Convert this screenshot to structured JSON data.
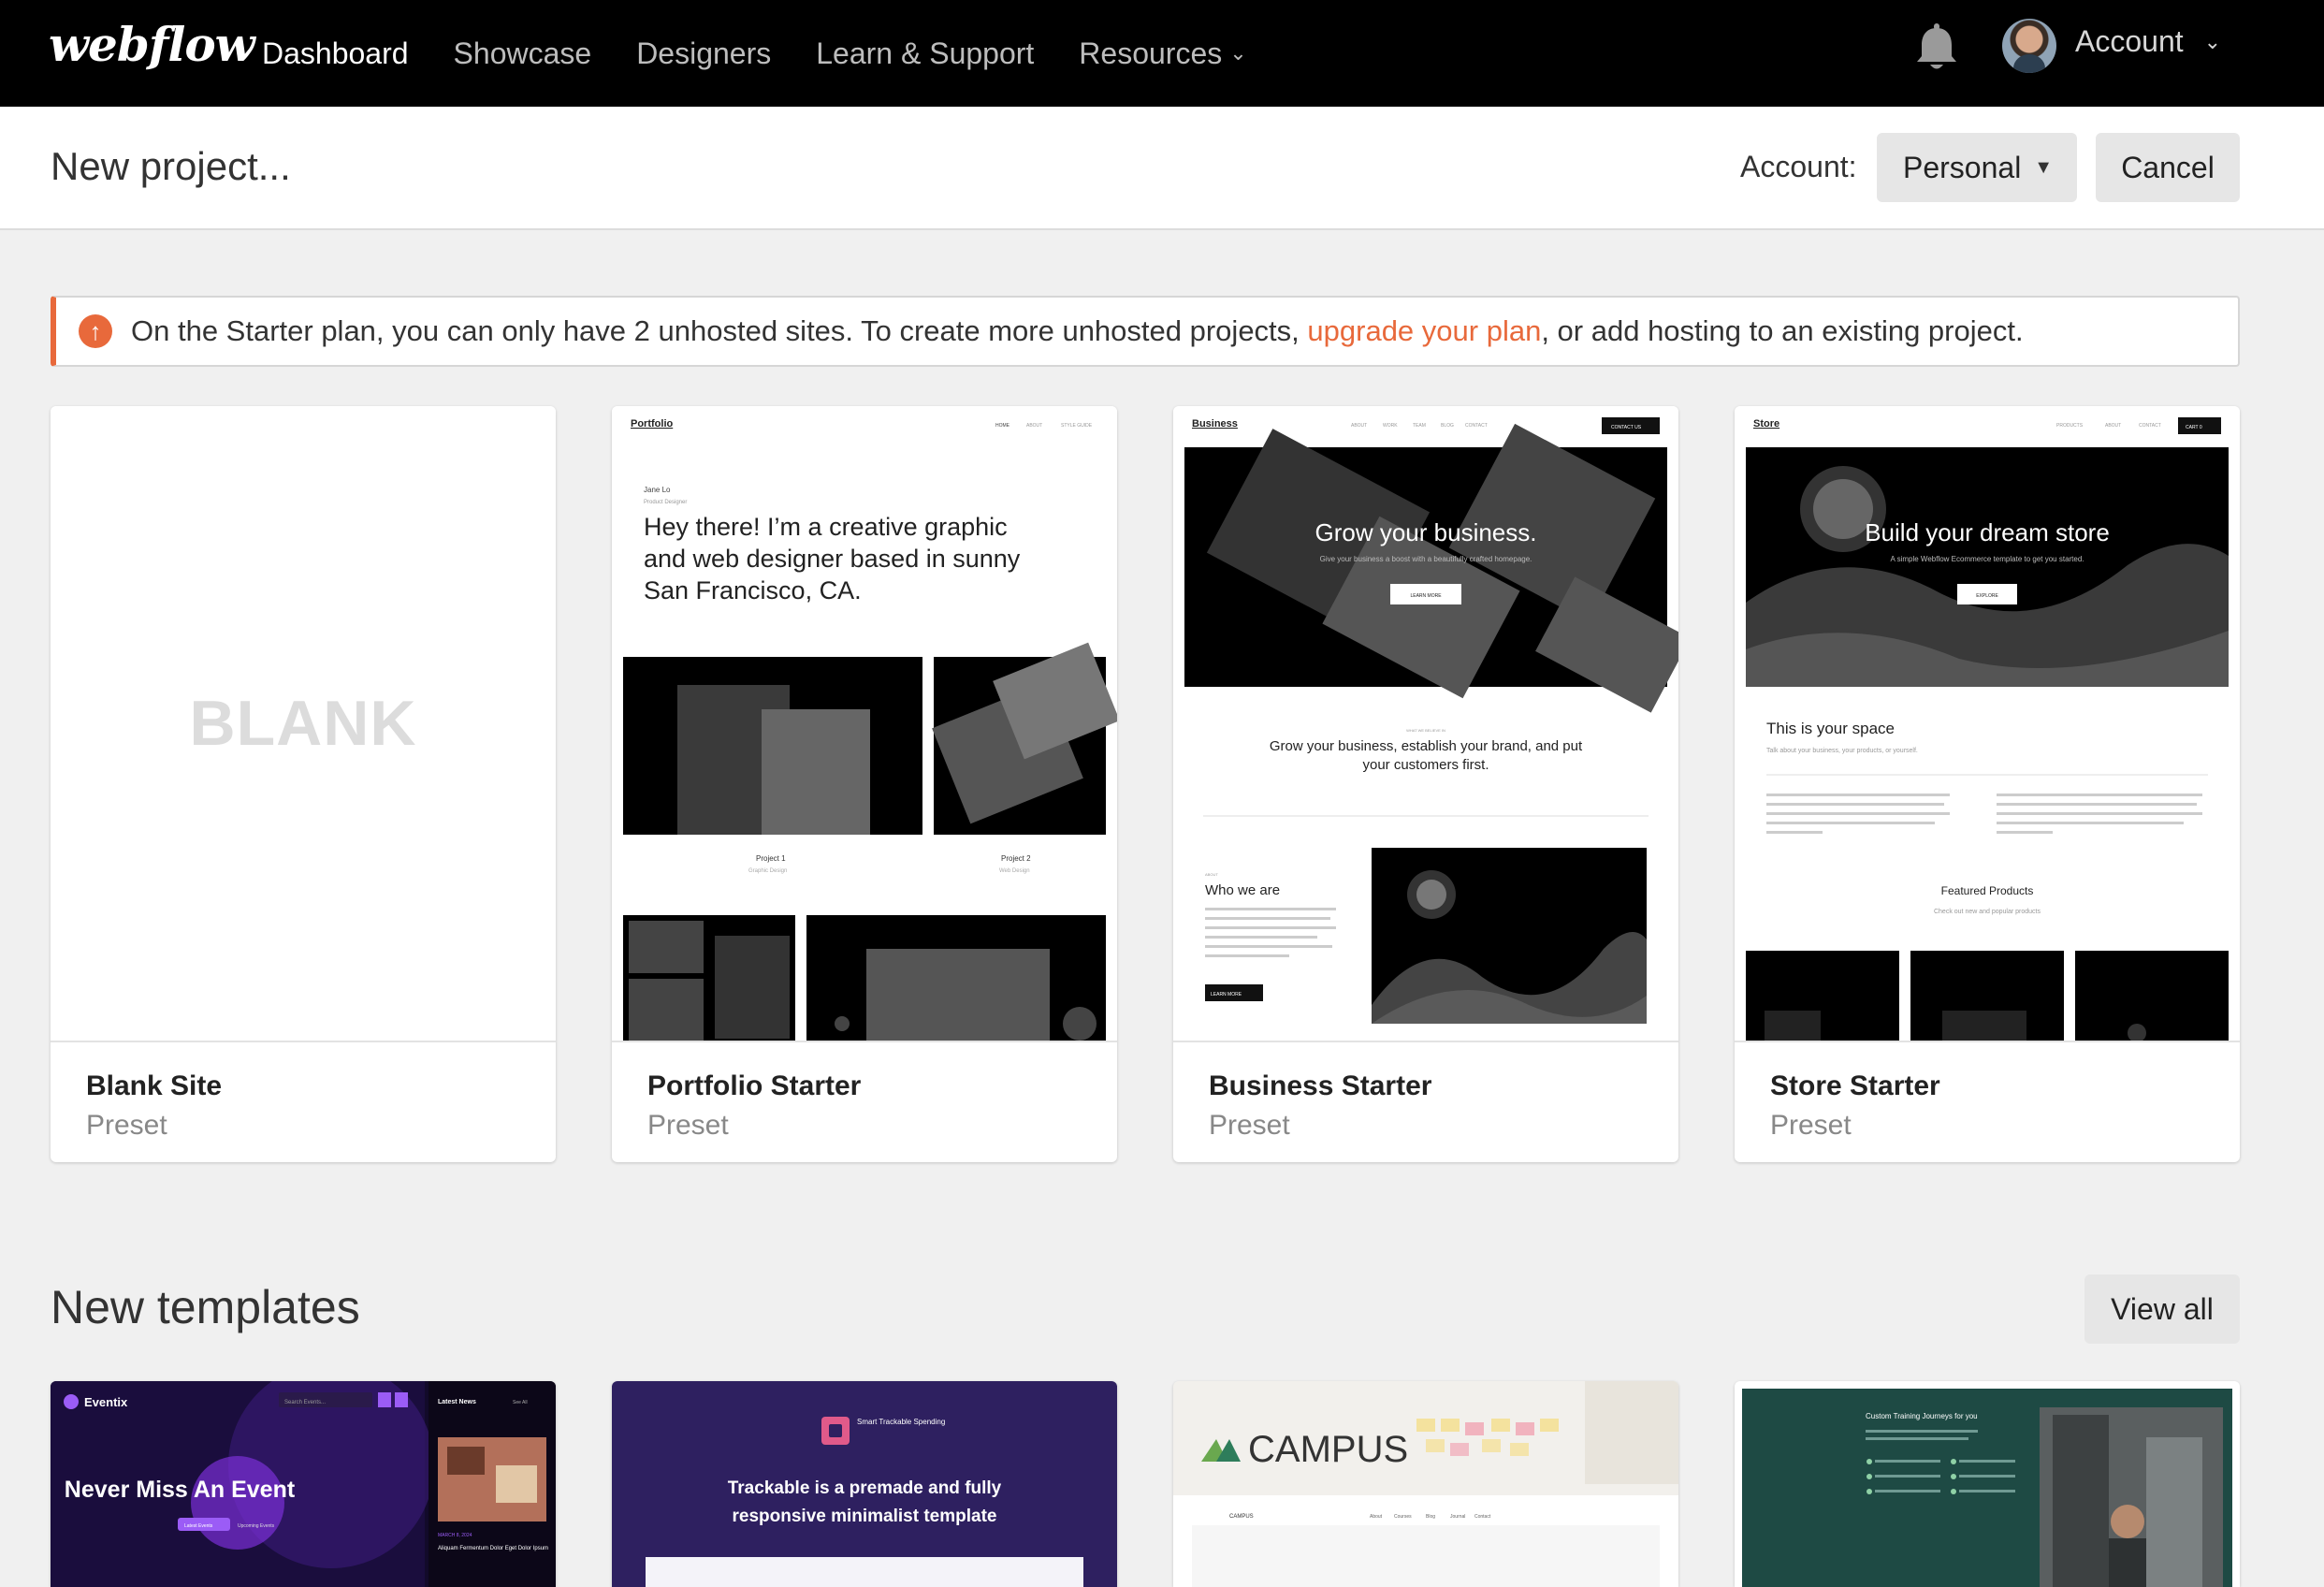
{
  "nav": {
    "logo": "webflow",
    "links": [
      {
        "label": "Dashboard"
      },
      {
        "label": "Showcase"
      },
      {
        "label": "Designers"
      },
      {
        "label": "Learn & Support"
      },
      {
        "label": "Resources"
      }
    ],
    "account_label": "Account"
  },
  "header": {
    "title": "New project...",
    "account_label": "Account:",
    "account_value": "Personal",
    "cancel_label": "Cancel"
  },
  "alert": {
    "text_before": "On the Starter plan, you can only have 2 unhosted sites. To create more unhosted projects, ",
    "link_text": "upgrade your plan",
    "text_after": ", or add hosting to an existing project."
  },
  "presets": [
    {
      "name": "Blank Site",
      "type": "Preset",
      "thumb_text": "BLANK"
    },
    {
      "name": "Portfolio Starter",
      "type": "Preset",
      "thumb": {
        "brand": "Portfolio",
        "nav": [
          "HOME",
          "ABOUT",
          "STYLE GUIDE"
        ],
        "person": "Jane Lo",
        "role": "Product Designer",
        "headline": [
          "Hey there! I’m a creative graphic",
          "and web designer based in sunny",
          "San Francisco, CA."
        ],
        "project1": "Project 1",
        "project1_sub": "Graphic Design",
        "project2": "Project 2",
        "project2_sub": "Web Design"
      }
    },
    {
      "name": "Business Starter",
      "type": "Preset",
      "thumb": {
        "brand": "Business",
        "nav": [
          "ABOUT",
          "WORK",
          "TEAM",
          "BLOG",
          "CONTACT"
        ],
        "cta": "CONTACT US",
        "hero": "Grow your business.",
        "hero_sub": "Give your business a boost with a beautifully crafted homepage.",
        "hero_btn": "LEARN MORE",
        "eyebrow": "WHAT WE BELIEVE IN",
        "statement": [
          "Grow your business, establish your brand, and put",
          "your customers first."
        ],
        "about_eyebrow": "ABOUT",
        "about_title": "Who we are",
        "about_btn": "LEARN MORE"
      }
    },
    {
      "name": "Store Starter",
      "type": "Preset",
      "thumb": {
        "brand": "Store",
        "nav": [
          "PRODUCTS",
          "ABOUT",
          "CONTACT"
        ],
        "cart": "CART 0",
        "hero": "Build your dream store",
        "hero_sub": "A simple Webflow Ecommerce template to get you started.",
        "hero_btn": "EXPLORE",
        "space_title": "This is your space",
        "space_sub": "Talk about your business, your products, or yourself.",
        "featured": "Featured Products",
        "featured_sub": "Check out new and popular products"
      }
    }
  ],
  "templates_section": {
    "title": "New templates",
    "view_all_label": "View all",
    "items": [
      {
        "brand": "Eventix",
        "headline": "Never Miss An Event",
        "search": "Search Events...",
        "news": "Latest News",
        "see_all": "See All",
        "btn1": "Latest Events",
        "btn2": "Upcoming Events",
        "news_date": "MARCH 8, 2024",
        "news_title": "Aliquam Fermentum Dolor Eget Dolor Ipsum"
      },
      {
        "brand": "Smart Trackable Spending",
        "headline": [
          "Trackable is a premade and fully",
          "responsive minimalist template"
        ]
      },
      {
        "brand": "CAMPUS",
        "nav": [
          "About",
          "Courses",
          "Blog",
          "Journal",
          "Contact"
        ]
      },
      {
        "headline": "Custom Training Journeys for you"
      }
    ]
  },
  "colors": {
    "accent": "#e8693b",
    "nav_bg": "#000000",
    "page_bg": "#f0f0f0"
  },
  "icons": [
    "bell-icon",
    "chevron-down-icon",
    "arrow-up-circle-icon",
    "caret-down-icon"
  ]
}
